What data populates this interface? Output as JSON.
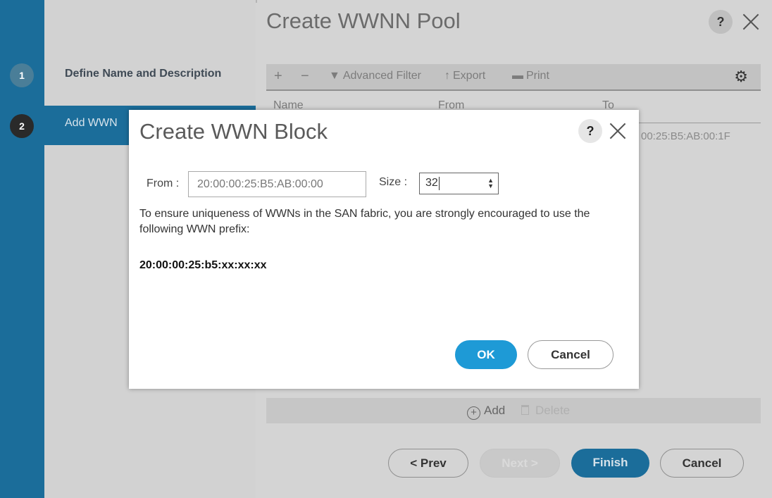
{
  "wizard": {
    "steps": [
      {
        "number": "1",
        "label": "Define Name and Description"
      },
      {
        "number": "2",
        "label": "Add WWN"
      }
    ]
  },
  "main": {
    "title": "Create WWNN Pool",
    "help_label": "?",
    "toolbar": {
      "add_label": "+",
      "remove_label": "−",
      "advanced_filter_label": "Advanced Filter",
      "export_label": "Export",
      "print_label": "Print"
    },
    "table": {
      "columns": [
        "Name",
        "From",
        "To"
      ],
      "rows": [
        {
          "to": "00:25:B5:AB:00:1F"
        }
      ]
    },
    "add_label": "Add",
    "delete_label": "Delete",
    "buttons": {
      "prev": "< Prev",
      "next": "Next >",
      "finish": "Finish",
      "cancel": "Cancel"
    }
  },
  "dialog": {
    "title": "Create WWN Block",
    "help_label": "?",
    "from_label": "From :",
    "from_value": "20:00:00:25:B5:AB:00:00",
    "size_label": "Size :",
    "size_value": "32",
    "hint": "To ensure uniqueness of WWNs in the SAN fabric, you are strongly encouraged to use the following WWN prefix:",
    "prefix": "20:00:00:25:b5:xx:xx:xx",
    "ok_label": "OK",
    "cancel_label": "Cancel"
  },
  "colors": {
    "rail_blue": "#1b6d9a",
    "ok_blue": "#1e9ad6",
    "overlay_gray": "#d4d4d4"
  },
  "icons": [
    "filter-icon",
    "export-icon",
    "print-icon",
    "gear-icon",
    "help-icon",
    "close-icon",
    "add-circle-icon",
    "trash-icon",
    "spinner-icon"
  ]
}
